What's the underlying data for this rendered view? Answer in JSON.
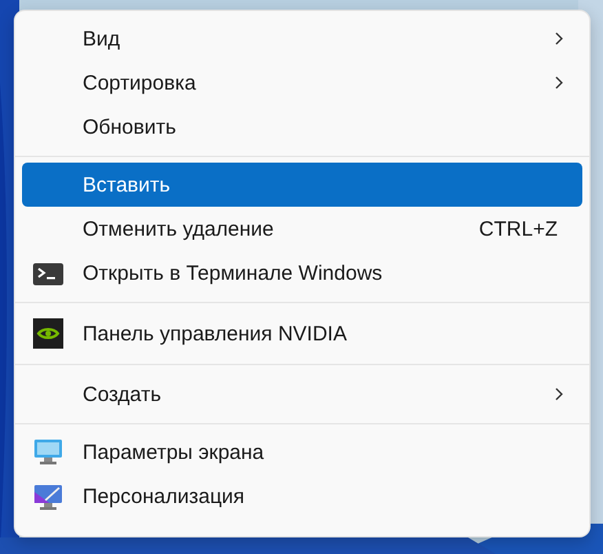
{
  "menu": {
    "sections": [
      {
        "items": [
          {
            "label": "Вид",
            "submenu": true,
            "selected": false
          },
          {
            "label": "Сортировка",
            "submenu": true,
            "selected": false
          },
          {
            "label": "Обновить",
            "submenu": false,
            "selected": false
          }
        ]
      },
      {
        "items": [
          {
            "label": "Вставить",
            "submenu": false,
            "selected": true
          },
          {
            "label": "Отменить удаление",
            "shortcut": "CTRL+Z",
            "submenu": false,
            "selected": false
          },
          {
            "label": "Открыть в Терминале Windows",
            "kind": "terminal",
            "submenu": false,
            "selected": false
          }
        ]
      },
      {
        "items": [
          {
            "label": "Панель управления NVIDIA",
            "kind": "nvidia",
            "submenu": false,
            "selected": false
          }
        ]
      },
      {
        "items": [
          {
            "label": "Создать",
            "submenu": true,
            "selected": false
          }
        ]
      },
      {
        "items": [
          {
            "label": "Параметры экрана",
            "kind": "display",
            "submenu": false,
            "selected": false
          },
          {
            "label": "Персонализация",
            "kind": "personalize",
            "submenu": false,
            "selected": false
          }
        ]
      }
    ]
  }
}
